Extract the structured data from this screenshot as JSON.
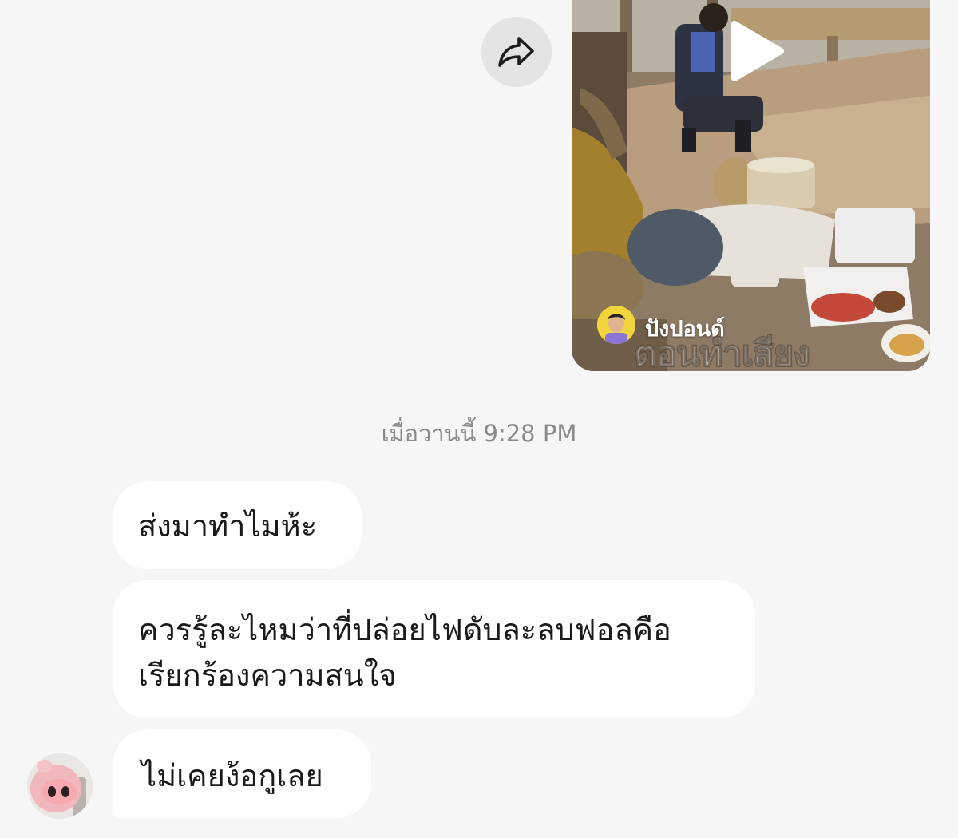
{
  "shared_post": {
    "author_name": "ปังปอนด์",
    "caption_overlay": "ตอนทำเสียง",
    "icons": {
      "share": "share-forward-icon",
      "play": "play-icon"
    }
  },
  "timestamp": "เมื่อวานนี้ 9:28 PM",
  "messages": [
    {
      "text": "ส่งมาทำไมห้ะ"
    },
    {
      "text": "ควรรู้ละไหมว่าที่ปล่อยไฟดับละลบฟอลคือ\nเรียกร้องความสนใจ"
    },
    {
      "text": "ไม่เคยง้อกูเลย"
    }
  ],
  "colors": {
    "background": "#f6f6f6",
    "bubble": "#ffffff",
    "timestamp_text": "#8a8a8e",
    "share_button": "#e4e4e6",
    "author_avatar_bg": "#f2d53c"
  }
}
